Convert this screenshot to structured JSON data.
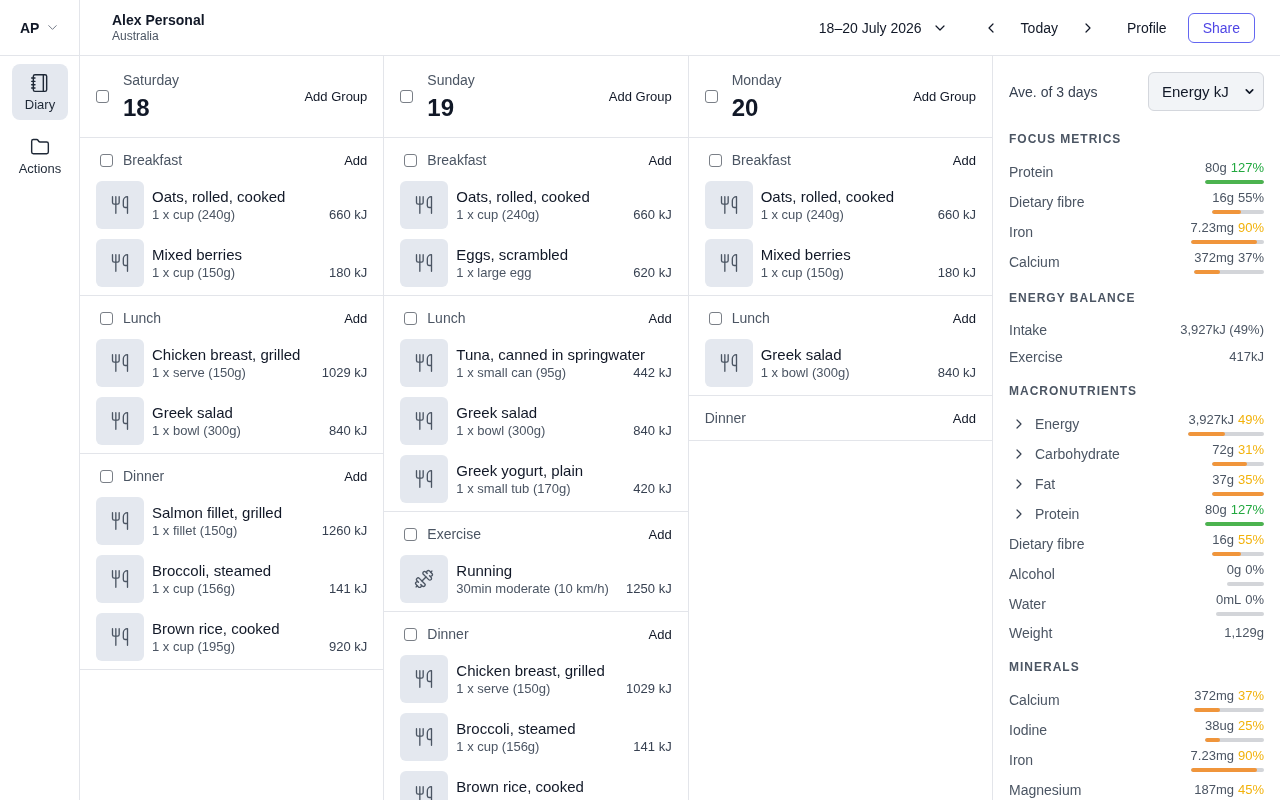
{
  "account": {
    "initials": "AP",
    "name": "Alex Personal",
    "region": "Australia"
  },
  "toolbar": {
    "date_range": "18–20 July 2026",
    "today": "Today",
    "profile": "Profile",
    "share": "Share"
  },
  "sidebar": {
    "items": [
      {
        "kind": "diary",
        "label": "Diary",
        "selected": true
      },
      {
        "kind": "actions",
        "label": "Actions",
        "selected": false
      }
    ]
  },
  "days": [
    {
      "weekday": "Saturday",
      "date": "18",
      "checked": false,
      "add_label": "Add Group",
      "groups": [
        {
          "name": "Breakfast",
          "checked": false,
          "add_label": "Add",
          "entries": [
            {
              "kind": "food",
              "name": "Oats, rolled, cooked",
              "detail": "1 x cup (240g)",
              "energy": "660 kJ"
            },
            {
              "kind": "food",
              "name": "Mixed berries",
              "detail": "1 x cup (150g)",
              "energy": "180 kJ"
            }
          ]
        },
        {
          "name": "Lunch",
          "checked": false,
          "add_label": "Add",
          "entries": [
            {
              "kind": "food",
              "name": "Chicken breast, grilled",
              "detail": "1 x serve (150g)",
              "energy": "1029 kJ"
            },
            {
              "kind": "food",
              "name": "Greek salad",
              "detail": "1 x bowl (300g)",
              "energy": "840 kJ"
            }
          ]
        },
        {
          "name": "Dinner",
          "checked": false,
          "add_label": "Add",
          "entries": [
            {
              "kind": "food",
              "name": "Salmon fillet, grilled",
              "detail": "1 x fillet (150g)",
              "energy": "1260 kJ"
            },
            {
              "kind": "food",
              "name": "Broccoli, steamed",
              "detail": "1 x cup (156g)",
              "energy": "141 kJ"
            },
            {
              "kind": "food",
              "name": "Brown rice, cooked",
              "detail": "1 x cup (195g)",
              "energy": "920 kJ"
            }
          ]
        }
      ]
    },
    {
      "weekday": "Sunday",
      "date": "19",
      "checked": false,
      "add_label": "Add Group",
      "groups": [
        {
          "name": "Breakfast",
          "checked": false,
          "add_label": "Add",
          "entries": [
            {
              "kind": "food",
              "name": "Oats, rolled, cooked",
              "detail": "1 x cup (240g)",
              "energy": "660 kJ"
            },
            {
              "kind": "food",
              "name": "Eggs, scrambled",
              "detail": "1 x large egg",
              "energy": "620 kJ"
            }
          ]
        },
        {
          "name": "Lunch",
          "checked": false,
          "add_label": "Add",
          "entries": [
            {
              "kind": "food",
              "name": "Tuna, canned in springwater",
              "detail": "1 x small can (95g)",
              "energy": "442 kJ"
            },
            {
              "kind": "food",
              "name": "Greek salad",
              "detail": "1 x bowl (300g)",
              "energy": "840 kJ"
            },
            {
              "kind": "food",
              "name": "Greek yogurt, plain",
              "detail": "1 x small tub (170g)",
              "energy": "420 kJ"
            }
          ]
        },
        {
          "name": "Exercise",
          "checked": false,
          "add_label": "Add",
          "entries": [
            {
              "kind": "exercise",
              "name": "Running",
              "detail": "30min moderate (10 km/h)",
              "energy": "1250 kJ"
            }
          ]
        },
        {
          "name": "Dinner",
          "checked": false,
          "add_label": "Add",
          "entries": [
            {
              "kind": "food",
              "name": "Chicken breast, grilled",
              "detail": "1 x serve (150g)",
              "energy": "1029 kJ"
            },
            {
              "kind": "food",
              "name": "Broccoli, steamed",
              "detail": "1 x cup (156g)",
              "energy": "141 kJ"
            },
            {
              "kind": "food",
              "name": "Brown rice, cooked"
            }
          ]
        }
      ]
    },
    {
      "weekday": "Monday",
      "date": "20",
      "checked": false,
      "add_label": "Add Group",
      "groups": [
        {
          "name": "Breakfast",
          "checked": false,
          "add_label": "Add",
          "entries": [
            {
              "kind": "food",
              "name": "Oats, rolled, cooked",
              "detail": "1 x cup (240g)",
              "energy": "660 kJ"
            },
            {
              "kind": "food",
              "name": "Mixed berries",
              "detail": "1 x cup (150g)",
              "energy": "180 kJ"
            }
          ]
        },
        {
          "name": "Lunch",
          "checked": false,
          "add_label": "Add",
          "entries": [
            {
              "kind": "food",
              "name": "Greek salad",
              "detail": "1 x bowl (300g)",
              "energy": "840 kJ"
            }
          ]
        },
        {
          "name": "Dinner",
          "add_label": "Add"
        }
      ]
    }
  ],
  "summary": {
    "period": "Ave. of 3 days",
    "metric": "Energy kJ",
    "sections": [
      {
        "title": "FOCUS METRICS",
        "rows": [
          {
            "kind": "bar",
            "label": "Protein",
            "value": "80g",
            "percent": {
              "text": "127%",
              "color": "#22a83f"
            },
            "bar": {
              "level": 1,
              "color": "#4cb34f"
            }
          },
          {
            "kind": "bar",
            "label": "Dietary fibre",
            "value": "16g",
            "percent": {
              "text": "55%",
              "color": "#4b5563"
            },
            "bar": {
              "level": 0.55,
              "color": "#f0953b"
            }
          },
          {
            "kind": "bar",
            "label": "Iron",
            "value": "7.23mg",
            "percent": {
              "text": "90%",
              "color": "#f2b20c"
            },
            "bar": {
              "level": 0.9,
              "color": "#f0953b"
            }
          },
          {
            "kind": "bar",
            "label": "Calcium",
            "value": "372mg",
            "percent": {
              "text": "37%",
              "color": "#4b5563"
            },
            "bar": {
              "level": 0.37,
              "color": "#f0953b"
            }
          }
        ]
      },
      {
        "title": "ENERGY BALANCE",
        "rows": [
          {
            "kind": "plain",
            "label": "Intake",
            "value": "3,927kJ (49%)"
          },
          {
            "kind": "plain",
            "label": "Exercise",
            "value": "417kJ"
          }
        ]
      },
      {
        "title": "MACRONUTRIENTS",
        "rows": [
          {
            "kind": "bar",
            "label": "Energy",
            "expanded": false,
            "value": "3,927kJ",
            "percent": {
              "text": "49%",
              "color": "#f2b20c"
            },
            "bar": {
              "level": 0.49,
              "color": "#f0953b"
            }
          },
          {
            "kind": "bar",
            "label": "Carbohydrate",
            "expanded": false,
            "value": "72g",
            "percent": {
              "text": "31%",
              "color": "#f2b20c"
            },
            "bar": {
              "level": 0.68,
              "color": "#f0953b"
            }
          },
          {
            "kind": "bar",
            "label": "Fat",
            "expanded": false,
            "value": "37g",
            "percent": {
              "text": "35%",
              "color": "#f2b20c"
            },
            "bar": {
              "level": 1,
              "color": "#f0953b"
            }
          },
          {
            "kind": "bar",
            "label": "Protein",
            "expanded": false,
            "value": "80g",
            "percent": {
              "text": "127%",
              "color": "#22a83f"
            },
            "bar": {
              "level": 1,
              "color": "#4cb34f"
            }
          },
          {
            "kind": "bar",
            "label": "Dietary fibre",
            "value": "16g",
            "percent": {
              "text": "55%",
              "color": "#f2b20c"
            },
            "bar": {
              "level": 0.55,
              "color": "#f0953b"
            }
          },
          {
            "kind": "empty",
            "label": "Alcohol",
            "value": "0g",
            "percent": {
              "text": "0%",
              "color": "#4b5563"
            }
          },
          {
            "kind": "empty",
            "label": "Water",
            "value": "0mL",
            "percent": {
              "text": "0%",
              "color": "#4b5563"
            }
          },
          {
            "kind": "plain",
            "label": "Weight",
            "value": "1,129g"
          }
        ]
      },
      {
        "title": "MINERALS",
        "rows": [
          {
            "kind": "bar",
            "label": "Calcium",
            "value": "372mg",
            "percent": {
              "text": "37%",
              "color": "#f2b20c"
            },
            "bar": {
              "level": 0.37,
              "color": "#f0953b"
            }
          },
          {
            "kind": "bar",
            "label": "Iodine",
            "value": "38ug",
            "percent": {
              "text": "25%",
              "color": "#f2b20c"
            },
            "bar": {
              "level": 0.25,
              "color": "#f0953b"
            }
          },
          {
            "kind": "bar",
            "label": "Iron",
            "value": "7.23mg",
            "percent": {
              "text": "90%",
              "color": "#f2b20c"
            },
            "bar": {
              "level": 0.9,
              "color": "#f0953b"
            }
          },
          {
            "kind": "bar",
            "label": "Magnesium",
            "value": "187mg",
            "percent": {
              "text": "45%",
              "color": "#f2b20c"
            }
          }
        ]
      }
    ]
  }
}
